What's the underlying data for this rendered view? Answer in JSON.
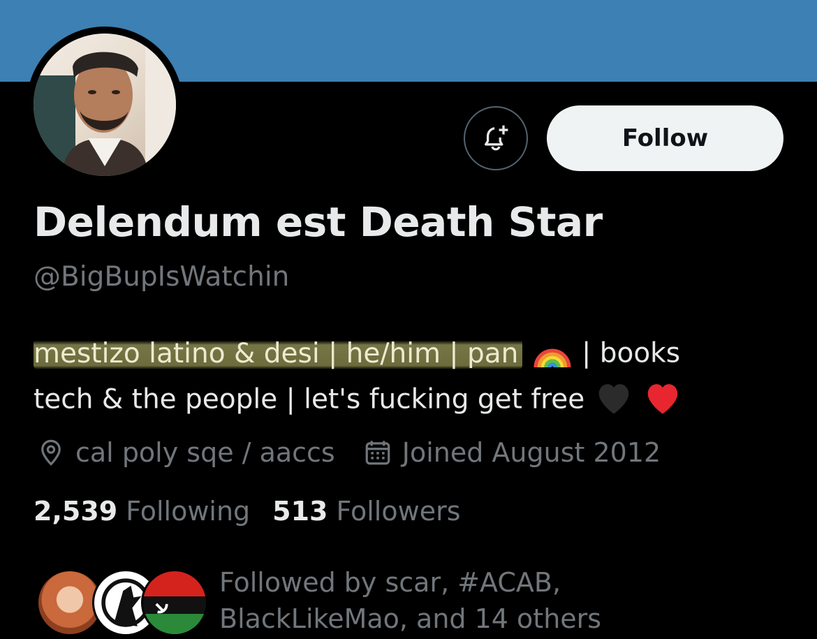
{
  "profile": {
    "display_name": "Delendum est Death Star",
    "handle": "@BigBupIsWatchin",
    "bio": {
      "highlighted": "mestizo latino & desi | he/him | pan",
      "rainbow_emoji": "🌈",
      "line1_rest": "| books",
      "line2": "tech & the people | let's fucking get free",
      "black_heart": "🖤",
      "red_heart": "❤️"
    },
    "location": "cal poly sqe / aaccs",
    "joined": "Joined August 2012",
    "location_icon": "map-pin-icon",
    "joined_icon": "calendar-icon"
  },
  "actions": {
    "follow_label": "Follow",
    "notify_icon": "bell-plus-icon"
  },
  "stats": {
    "following_count": "2,539",
    "following_label": "Following",
    "followers_count": "513",
    "followers_label": "Followers"
  },
  "followed_by": {
    "line1": "Followed by scar, #ACAB,",
    "line2": "BlackLikeMao, and 14 others"
  },
  "colors": {
    "banner": "#3d80b3",
    "background": "#000000",
    "primary_text": "#e7e9ea",
    "secondary_text": "#71767b",
    "follow_button_bg": "#eff3f4",
    "highlight": "#d6d680"
  }
}
